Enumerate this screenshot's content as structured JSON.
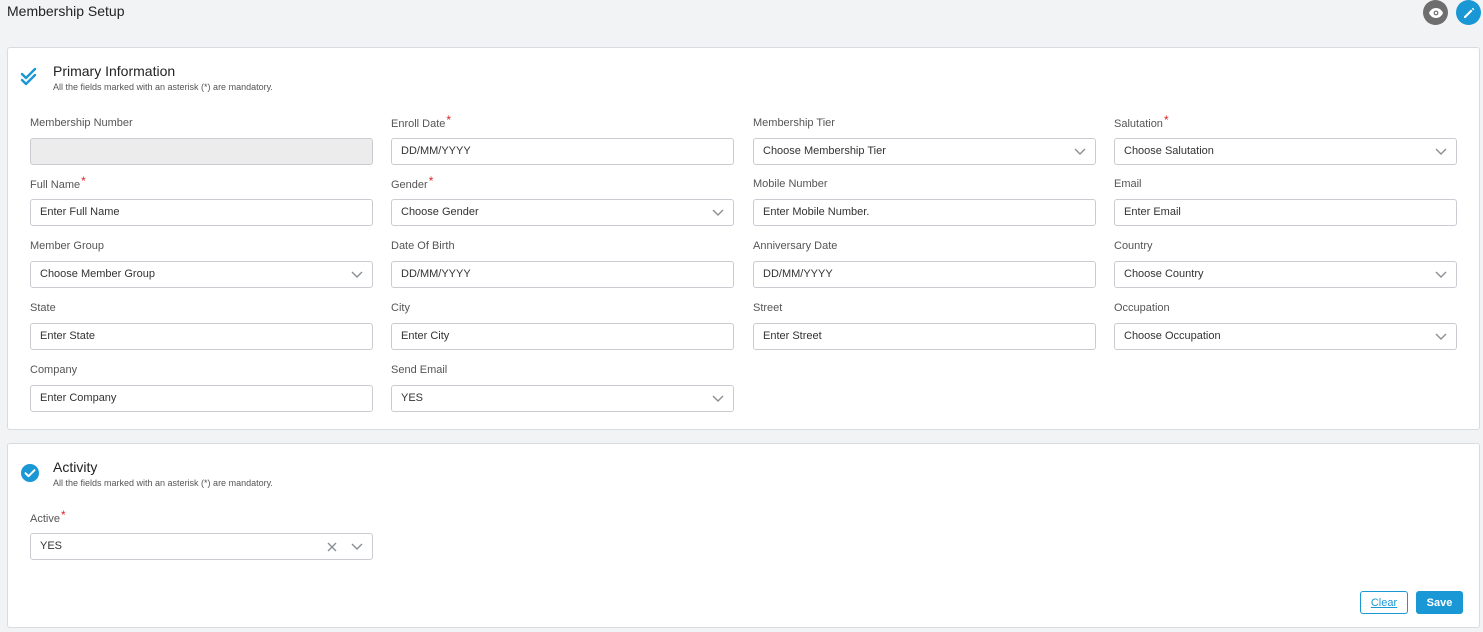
{
  "page": {
    "title": "Membership Setup"
  },
  "primary": {
    "title": "Primary Information",
    "subtitle": "All the fields marked with an asterisk (*) are mandatory.",
    "fields": {
      "membership_number": {
        "label": "Membership Number",
        "value": ""
      },
      "enroll_date": {
        "label": "Enroll Date",
        "placeholder": "DD/MM/YYYY"
      },
      "membership_tier": {
        "label": "Membership Tier",
        "placeholder": "Choose Membership Tier"
      },
      "salutation": {
        "label": "Salutation",
        "placeholder": "Choose Salutation"
      },
      "full_name": {
        "label": "Full Name",
        "placeholder": "Enter Full Name"
      },
      "gender": {
        "label": "Gender",
        "placeholder": "Choose Gender"
      },
      "mobile_number": {
        "label": "Mobile Number",
        "placeholder": "Enter Mobile Number."
      },
      "email": {
        "label": "Email",
        "placeholder": "Enter Email"
      },
      "member_group": {
        "label": "Member Group",
        "placeholder": "Choose Member Group"
      },
      "date_of_birth": {
        "label": "Date Of Birth",
        "placeholder": "DD/MM/YYYY"
      },
      "anniversary_date": {
        "label": "Anniversary Date",
        "placeholder": "DD/MM/YYYY"
      },
      "country": {
        "label": "Country",
        "placeholder": "Choose Country"
      },
      "state": {
        "label": "State",
        "placeholder": "Enter State"
      },
      "city": {
        "label": "City",
        "placeholder": "Enter City"
      },
      "street": {
        "label": "Street",
        "placeholder": "Enter Street"
      },
      "occupation": {
        "label": "Occupation",
        "placeholder": "Choose Occupation"
      },
      "company": {
        "label": "Company",
        "placeholder": "Enter Company"
      },
      "send_email": {
        "label": "Send Email",
        "value": "YES"
      }
    }
  },
  "activity": {
    "title": "Activity",
    "subtitle": "All the fields marked with an asterisk (*) are mandatory.",
    "fields": {
      "active": {
        "label": "Active",
        "value": "YES"
      }
    }
  },
  "actions": {
    "clear_label": "Clear",
    "save_label": "Save"
  },
  "required_mark": "*",
  "colors": {
    "accent": "#1a97d5",
    "required": "#e02424",
    "view_button": "#6e6e6e"
  },
  "icons": {
    "view": "eye-icon",
    "edit": "pencil-icon",
    "section": "check-icon",
    "dropdown": "chevron-down-icon",
    "clear": "close-icon"
  }
}
